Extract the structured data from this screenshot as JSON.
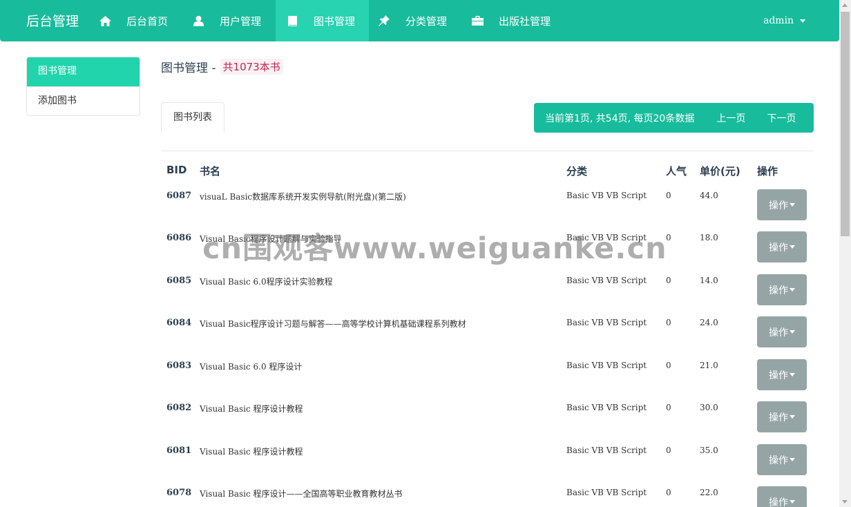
{
  "navbar": {
    "brand": "后台管理",
    "items": [
      {
        "label": "后台首页",
        "icon": "home-icon",
        "active": false
      },
      {
        "label": "用户管理",
        "icon": "user-icon",
        "active": false
      },
      {
        "label": "图书管理",
        "icon": "book-icon",
        "active": true
      },
      {
        "label": "分类管理",
        "icon": "pushpin-icon",
        "active": false
      },
      {
        "label": "出版社管理",
        "icon": "briefcase-icon",
        "active": false
      }
    ],
    "user": "admin"
  },
  "sidebar": {
    "items": [
      {
        "label": "图书管理",
        "active": true
      },
      {
        "label": "添加图书",
        "active": false
      }
    ]
  },
  "main": {
    "title": "图书管理 -",
    "count_badge": "共1073本书",
    "tab": "图书列表",
    "pager": {
      "info": "当前第1页, 共54页, 每页20条数据",
      "prev": "上一页",
      "next": "下一页"
    },
    "table": {
      "headers": [
        "BID",
        "书名",
        "分类",
        "人气",
        "单价(元)",
        "操作"
      ],
      "op_label": "操作",
      "rows": [
        {
          "bid": "6087",
          "name": "visuaL Basic数据库系统开发实例导航(附光盘)(第二版)",
          "category": "Basic VB VB Script",
          "popularity": "0",
          "price": "44.0"
        },
        {
          "bid": "6086",
          "name": "Visual Basic程序设计题解与实验指导",
          "category": "Basic VB VB Script",
          "popularity": "0",
          "price": "18.0"
        },
        {
          "bid": "6085",
          "name": "Visual Basic 6.0程序设计实验教程",
          "category": "Basic VB VB Script",
          "popularity": "0",
          "price": "14.0"
        },
        {
          "bid": "6084",
          "name": "Visual Basic程序设计习题与解答——高等学校计算机基础课程系列教材",
          "category": "Basic VB VB Script",
          "popularity": "0",
          "price": "24.0"
        },
        {
          "bid": "6083",
          "name": "Visual Basic 6.0 程序设计",
          "category": "Basic VB VB Script",
          "popularity": "0",
          "price": "21.0"
        },
        {
          "bid": "6082",
          "name": "Visual Basic 程序设计教程",
          "category": "Basic VB VB Script",
          "popularity": "0",
          "price": "30.0"
        },
        {
          "bid": "6081",
          "name": "Visual Basic 程序设计教程",
          "category": "Basic VB VB Script",
          "popularity": "0",
          "price": "35.0"
        },
        {
          "bid": "6078",
          "name": "Visual Basic 程序设计——全国高等职业教育教材丛书",
          "category": "Basic VB VB Script",
          "popularity": "0",
          "price": "22.0"
        }
      ]
    }
  },
  "watermark": "cn围观客www.weiguanke.cn",
  "colors": {
    "primary": "#18bc9c",
    "active": "#27d3b1",
    "op_button": "#95a5a6",
    "badge_text": "#c7254e"
  }
}
